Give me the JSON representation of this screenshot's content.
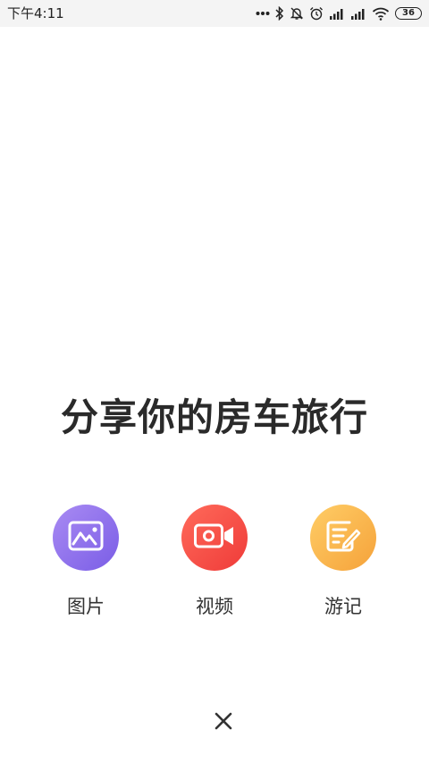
{
  "status_bar": {
    "time": "下午4:11",
    "battery": "36",
    "icons": [
      "more-dots-icon",
      "bluetooth-icon",
      "notifications-off-icon",
      "alarm-icon",
      "signal-icon",
      "signal-icon",
      "wifi-icon",
      "battery-icon"
    ]
  },
  "headline": "分享你的房车旅行",
  "options": [
    {
      "label": "图片",
      "icon": "image-icon",
      "color": "#8b6cef"
    },
    {
      "label": "视频",
      "icon": "video-camera-icon",
      "color": "#f44a42"
    },
    {
      "label": "游记",
      "icon": "note-edit-icon",
      "color": "#f8b64a"
    }
  ],
  "close_icon": "close-icon"
}
